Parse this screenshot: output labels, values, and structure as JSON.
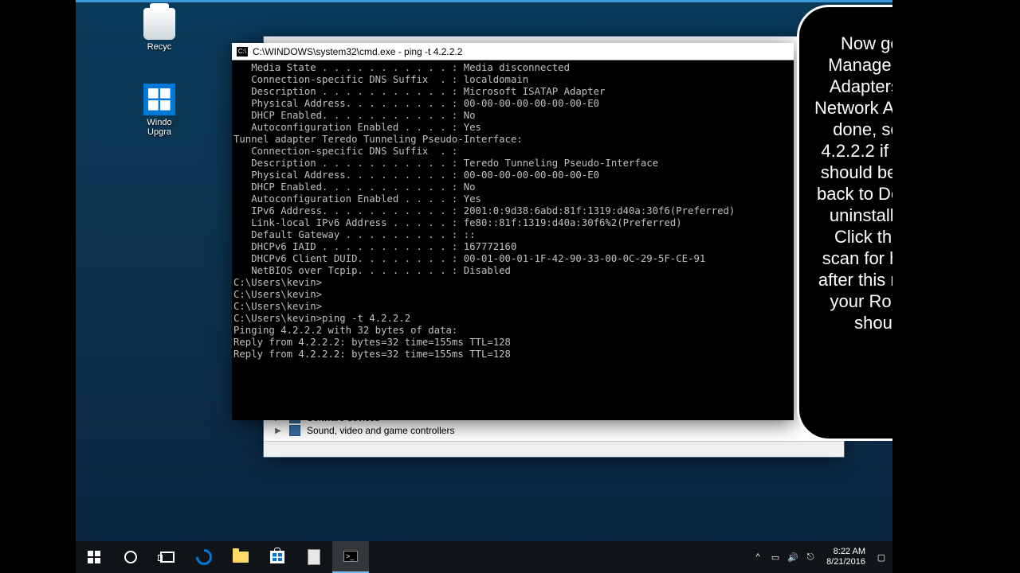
{
  "desktop": {
    "recycle_label": "Recyc",
    "upgrade_label_line1": "Windo",
    "upgrade_label_line2": "Upgra"
  },
  "devmgr": {
    "items": [
      {
        "label": "Software devices"
      },
      {
        "label": "Sound, video and game controllers"
      }
    ]
  },
  "cmd": {
    "title": "C:\\WINDOWS\\system32\\cmd.exe - ping  -t 4.2.2.2",
    "lines": [
      "   Media State . . . . . . . . . . . : Media disconnected",
      "   Connection-specific DNS Suffix  . : localdomain",
      "   Description . . . . . . . . . . . : Microsoft ISATAP Adapter",
      "   Physical Address. . . . . . . . . : 00-00-00-00-00-00-00-E0",
      "   DHCP Enabled. . . . . . . . . . . : No",
      "   Autoconfiguration Enabled . . . . : Yes",
      "",
      "Tunnel adapter Teredo Tunneling Pseudo-Interface:",
      "",
      "   Connection-specific DNS Suffix  . :",
      "   Description . . . . . . . . . . . : Teredo Tunneling Pseudo-Interface",
      "   Physical Address. . . . . . . . . : 00-00-00-00-00-00-00-E0",
      "   DHCP Enabled. . . . . . . . . . . : No",
      "   Autoconfiguration Enabled . . . . : Yes",
      "   IPv6 Address. . . . . . . . . . . : 2001:0:9d38:6abd:81f:1319:d40a:30f6(Preferred)",
      "   Link-local IPv6 Address . . . . . : fe80::81f:1319:d40a:30f6%2(Preferred)",
      "   Default Gateway . . . . . . . . . : ::",
      "   DHCPv6 IAID . . . . . . . . . . . : 167772160",
      "   DHCPv6 Client DUID. . . . . . . . : 00-01-00-01-1F-42-90-33-00-0C-29-5F-CE-91",
      "   NetBIOS over Tcpip. . . . . . . . : Disabled",
      "",
      "C:\\Users\\kevin>",
      "C:\\Users\\kevin>",
      "C:\\Users\\kevin>",
      "C:\\Users\\kevin>ping -t 4.2.2.2",
      "",
      "Pinging 4.2.2.2 with 32 bytes of data:",
      "Reply from 4.2.2.2: bytes=32 time=155ms TTL=128",
      "Reply from 4.2.2.2: bytes=32 time=155ms TTL=128"
    ]
  },
  "callout": {
    "text": "Now go back to Device Manager, expand Network Adapters and update your Network Adapter Driver. Once done, see if you can ping 4.2.2.2 if yes, then the issue should be resovled, if not go back to Device Manager, and uninstall the Adapter.  then Click the Actions tab and scan for hardware changes, after this reboot your PC and your Router and the issue should be resolved."
  },
  "taskbar": {
    "time": "8:22 AM",
    "date": "8/21/2016"
  }
}
